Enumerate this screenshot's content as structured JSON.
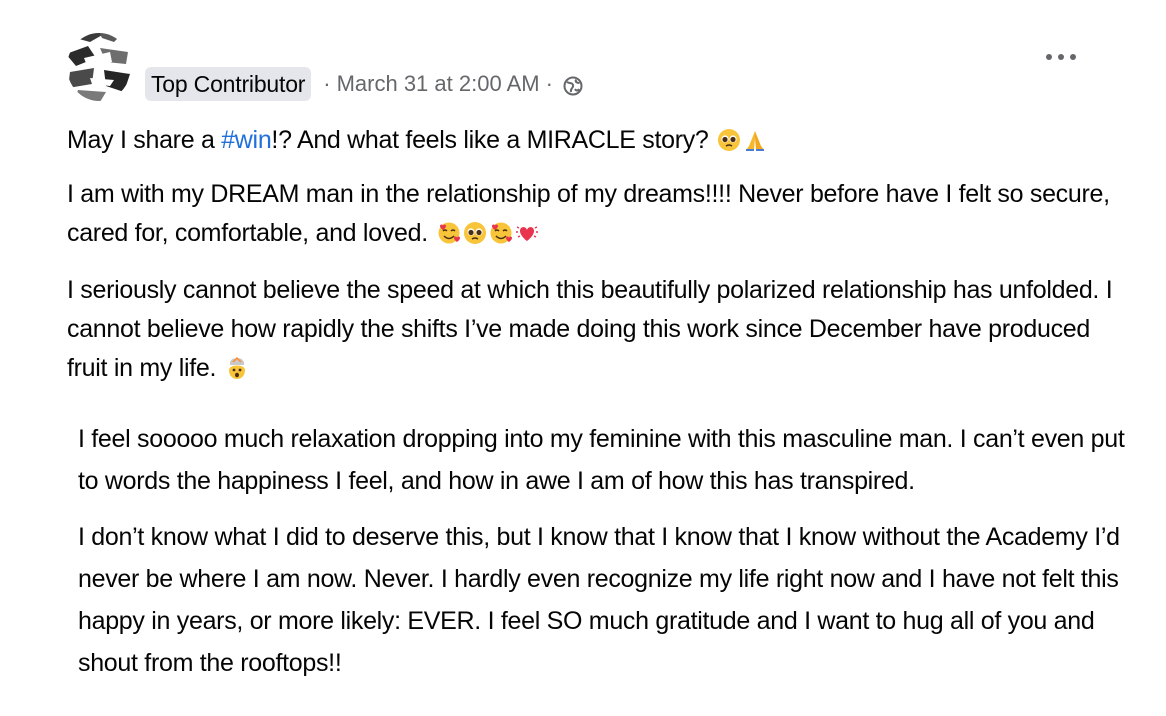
{
  "post": {
    "badge": "Top Contributor",
    "meta_date": "March 31 at 2:00 AM",
    "meta_sep": "·",
    "icons": {
      "avatar": "avatar-image",
      "audience": "globe-icon",
      "more": "more-options-icon"
    },
    "paragraphs": {
      "p1": {
        "before": "May I share a ",
        "hashtag": "#win",
        "after": "!? And what feels like a  MIRACLE story? ",
        "emojis": [
          "pleading-face-emoji",
          "folded-hands-emoji"
        ]
      },
      "p2": {
        "text": "I am with my DREAM man in the relationship of my dreams!!!! Never before have I felt so secure, cared for, comfortable, and loved. ",
        "emojis": [
          "smiling-face-with-hearts-emoji",
          "pleading-face-emoji",
          "smiling-face-with-hearts-emoji",
          "beating-heart-emoji"
        ]
      },
      "p3": {
        "text": "I seriously cannot believe the speed at which this beautifully polarized relationship has unfolded. I cannot believe how rapidly the shifts I’ve made doing this work since December have produced fruit in my life. ",
        "emojis": [
          "exploding-head-emoji"
        ]
      },
      "p4": {
        "text": "I feel sooooo much relaxation dropping into my feminine with this masculine man. I can’t even put to words the happiness I feel, and how in awe I am of how this has transpired."
      },
      "p5": {
        "text": "I don’t know what I did to deserve this, but I know that I know that I know without the Academy I’d never be where I am now. Never. I hardly even recognize my life right now and I have not felt this happy in years, or more likely: EVER. I feel SO much gratitude and I want to hug all of you and shout from the rooftops!!"
      }
    }
  }
}
